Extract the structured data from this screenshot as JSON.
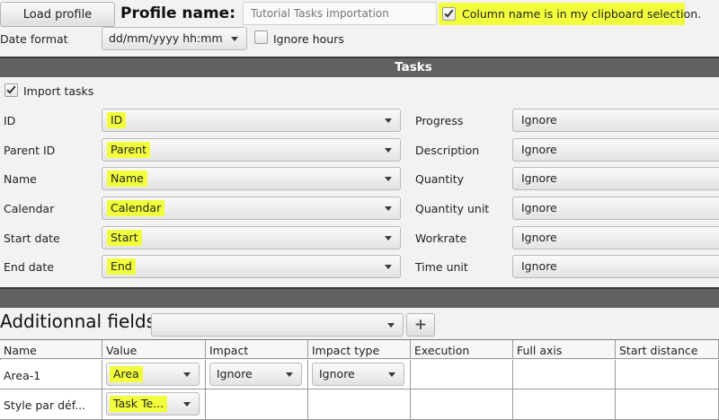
{
  "toolbar": {
    "load_profile_label": "Load profile",
    "profile_name_label": "Profile name:",
    "profile_name_placeholder": "Tutorial Tasks importation",
    "column_name_checkbox_label": "Column name is in my clipboard selection."
  },
  "date_row": {
    "date_format_label": "Date format",
    "date_format_value": "dd/mm/yyyy hh:mm",
    "ignore_hours_label": "Ignore hours"
  },
  "tasks": {
    "section_title": "Tasks",
    "import_tasks_label": "Import tasks",
    "left_fields": [
      {
        "label": "ID",
        "value": "ID"
      },
      {
        "label": "Parent ID",
        "value": "Parent"
      },
      {
        "label": "Name",
        "value": "Name"
      },
      {
        "label": "Calendar",
        "value": "Calendar"
      },
      {
        "label": "Start date",
        "value": "Start"
      },
      {
        "label": "End date",
        "value": "End"
      }
    ],
    "right_fields": [
      {
        "label": "Progress",
        "value": "Ignore"
      },
      {
        "label": "Description",
        "value": "Ignore"
      },
      {
        "label": "Quantity",
        "value": "Ignore"
      },
      {
        "label": "Quantity unit",
        "value": "Ignore"
      },
      {
        "label": "Workrate",
        "value": "Ignore"
      },
      {
        "label": "Time unit",
        "value": "Ignore"
      }
    ]
  },
  "additional": {
    "title": "Additionnal fields",
    "add_label": "+",
    "columns": [
      "Name",
      "Value",
      "Impact",
      "Impact type",
      "Execution",
      "Full axis",
      "Start distance"
    ],
    "rows": [
      {
        "name": "Area-1",
        "value": "Area",
        "impact": "Ignore",
        "impact_type": "Ignore"
      },
      {
        "name": "Style par déf...",
        "value": "Task Te..."
      }
    ]
  },
  "colors": {
    "highlight": "#f2ff3c",
    "section_bar": "#616161"
  }
}
